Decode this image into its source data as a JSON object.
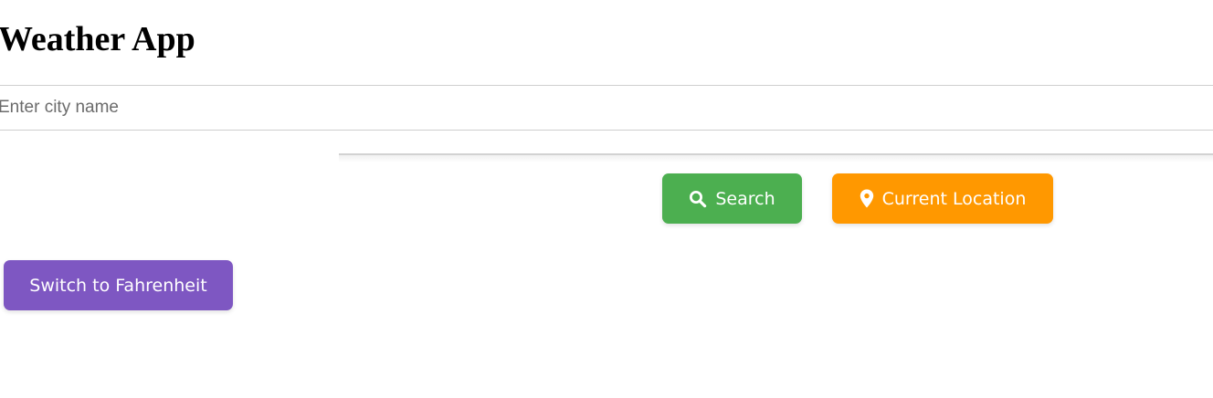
{
  "app": {
    "title": "Weather App"
  },
  "search": {
    "placeholder": "Enter city name",
    "value": ""
  },
  "actions": {
    "search_label": "Search",
    "search_icon": "search-icon",
    "location_label": "Current Location",
    "location_icon": "map-pin-icon",
    "unit_toggle_label": "Switch to Fahrenheit"
  },
  "colors": {
    "search_button": "#4caf50",
    "location_button": "#ff9800",
    "unit_button": "#7e57c2"
  }
}
